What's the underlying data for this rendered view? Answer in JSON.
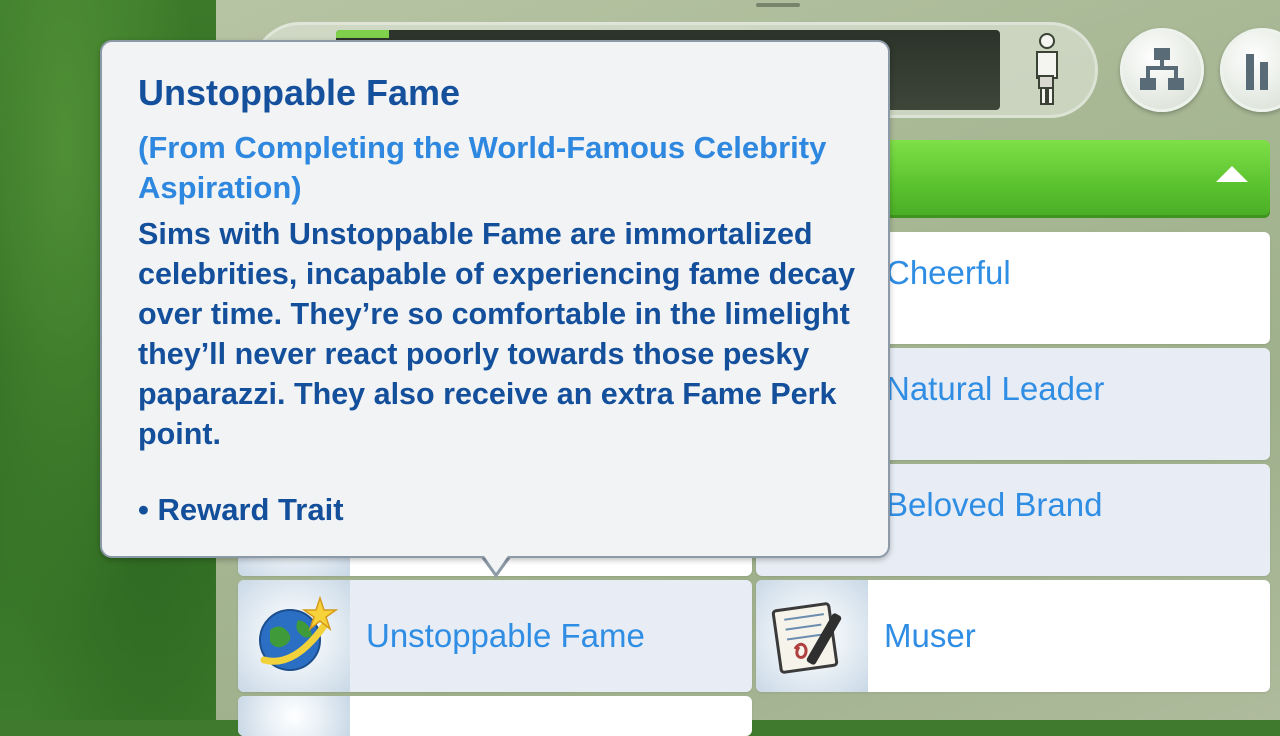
{
  "tooltip": {
    "title": "Unstoppable Fame",
    "subtitle": "(From Completing the World-Famous Celebrity Aspiration)",
    "body": "Sims with Unstoppable Fame are immortalized celebrities, incapable of experiencing fame decay over time. They’re so comfortable in the limelight they’ll never react poorly towards those pesky paparazzi. They also receive an extra Fame Perk point.",
    "bullet": "• Reward Trait"
  },
  "traits": {
    "left": [
      {
        "label": "Unstoppable Fame",
        "icon": "globe-star-icon"
      }
    ],
    "right": [
      {
        "label": "Cheerful"
      },
      {
        "label": "Natural Leader"
      },
      {
        "label": "Beloved Brand"
      },
      {
        "label": "Muser",
        "icon": "notepad-pen-icon"
      }
    ]
  },
  "top_bar": {
    "fame_progress": 0.08,
    "icons": [
      "sim-figure-icon",
      "hierarchy-icon",
      "bar-chart-icon"
    ]
  },
  "colors": {
    "accent_blue": "#2f8ee4",
    "title_blue": "#14509c",
    "header_green": "#5cc430"
  }
}
